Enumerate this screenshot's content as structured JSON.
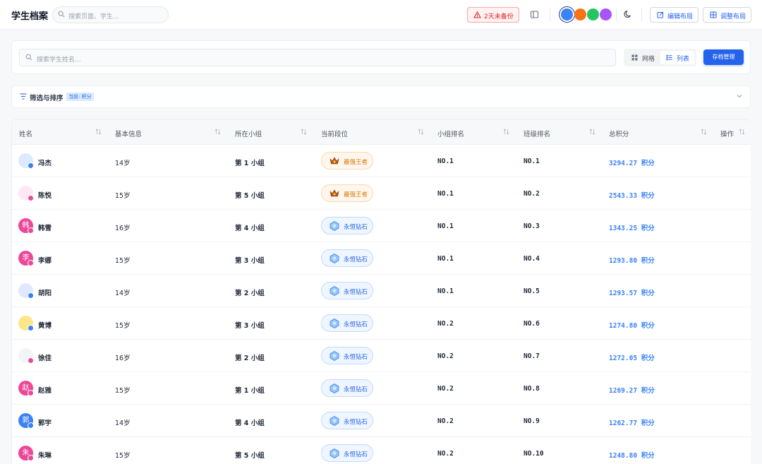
{
  "header": {
    "title": "学生档案",
    "search_placeholder": "搜索页面、学生...",
    "backup_warning": "2天未备份",
    "theme_colors": [
      "#3b82f6",
      "#f97316",
      "#22c55e",
      "#a855f7"
    ],
    "edit_layout": "编辑布局",
    "adjust_layout": "调整布局"
  },
  "search": {
    "placeholder": "搜索学生姓名...",
    "view_grid": "网格",
    "view_list": "列表",
    "active_view": "列表",
    "archive_button": "存档管理"
  },
  "filter": {
    "label": "筛选与排序",
    "current_tag": "当前: 积分"
  },
  "table": {
    "columns": [
      "姓名",
      "基本信息",
      "所在小组",
      "当前段位",
      "小组排名",
      "班级排名",
      "总积分",
      "操作"
    ],
    "rows": [
      {
        "name": "冯杰",
        "age": "14岁",
        "group": "第 1 小组",
        "rank_tier": "最强王者",
        "tier_style": "gold",
        "group_rank": "NO.1",
        "class_rank": "NO.1",
        "score": "3294.27 积分",
        "avatar_char": "",
        "avatar_color": "#dbeafe",
        "gender_color": "#3b82f6"
      },
      {
        "name": "陈悦",
        "age": "15岁",
        "group": "第 5 小组",
        "rank_tier": "最强王者",
        "tier_style": "gold",
        "group_rank": "NO.1",
        "class_rank": "NO.2",
        "score": "2543.33 积分",
        "avatar_char": "",
        "avatar_color": "#fce7f3",
        "gender_color": "#ec4899"
      },
      {
        "name": "韩雪",
        "age": "16岁",
        "group": "第 4 小组",
        "rank_tier": "永恒钻石",
        "tier_style": "blue",
        "group_rank": "NO.1",
        "class_rank": "NO.3",
        "score": "1343.25 积分",
        "avatar_char": "韩",
        "avatar_color": "#ec4899",
        "gender_color": "#ec4899"
      },
      {
        "name": "李娜",
        "age": "15岁",
        "group": "第 3 小组",
        "rank_tier": "永恒钻石",
        "tier_style": "blue",
        "group_rank": "NO.1",
        "class_rank": "NO.4",
        "score": "1293.80 积分",
        "avatar_char": "李",
        "avatar_color": "#ec4899",
        "gender_color": "#ec4899"
      },
      {
        "name": "胡阳",
        "age": "14岁",
        "group": "第 2 小组",
        "rank_tier": "永恒钻石",
        "tier_style": "blue",
        "group_rank": "NO.1",
        "class_rank": "NO.5",
        "score": "1293.57 积分",
        "avatar_char": "",
        "avatar_color": "#e0e7ff",
        "gender_color": "#3b82f6"
      },
      {
        "name": "黄博",
        "age": "15岁",
        "group": "第 3 小组",
        "rank_tier": "永恒钻石",
        "tier_style": "blue",
        "group_rank": "NO.2",
        "class_rank": "NO.6",
        "score": "1274.80 积分",
        "avatar_char": "",
        "avatar_color": "#fde68a",
        "gender_color": "#3b82f6"
      },
      {
        "name": "徐佳",
        "age": "16岁",
        "group": "第 2 小组",
        "rank_tier": "永恒钻石",
        "tier_style": "blue",
        "group_rank": "NO.2",
        "class_rank": "NO.7",
        "score": "1272.05 积分",
        "avatar_char": "",
        "avatar_color": "#f3f4f6",
        "gender_color": "#ec4899"
      },
      {
        "name": "赵雅",
        "age": "15岁",
        "group": "第 1 小组",
        "rank_tier": "永恒钻石",
        "tier_style": "blue",
        "group_rank": "NO.2",
        "class_rank": "NO.8",
        "score": "1269.27 积分",
        "avatar_char": "赵",
        "avatar_color": "#ec4899",
        "gender_color": "#ec4899"
      },
      {
        "name": "郭宇",
        "age": "14岁",
        "group": "第 4 小组",
        "rank_tier": "永恒钻石",
        "tier_style": "blue",
        "group_rank": "NO.2",
        "class_rank": "NO.9",
        "score": "1262.77 积分",
        "avatar_char": "郭",
        "avatar_color": "#3b82f6",
        "gender_color": "#3b82f6"
      },
      {
        "name": "朱琳",
        "age": "15岁",
        "group": "第 5 小组",
        "rank_tier": "永恒钻石",
        "tier_style": "blue",
        "group_rank": "NO.2",
        "class_rank": "NO.10",
        "score": "1248.80 积分",
        "avatar_char": "朱",
        "avatar_color": "#ec4899",
        "gender_color": "#ec4899"
      }
    ]
  }
}
